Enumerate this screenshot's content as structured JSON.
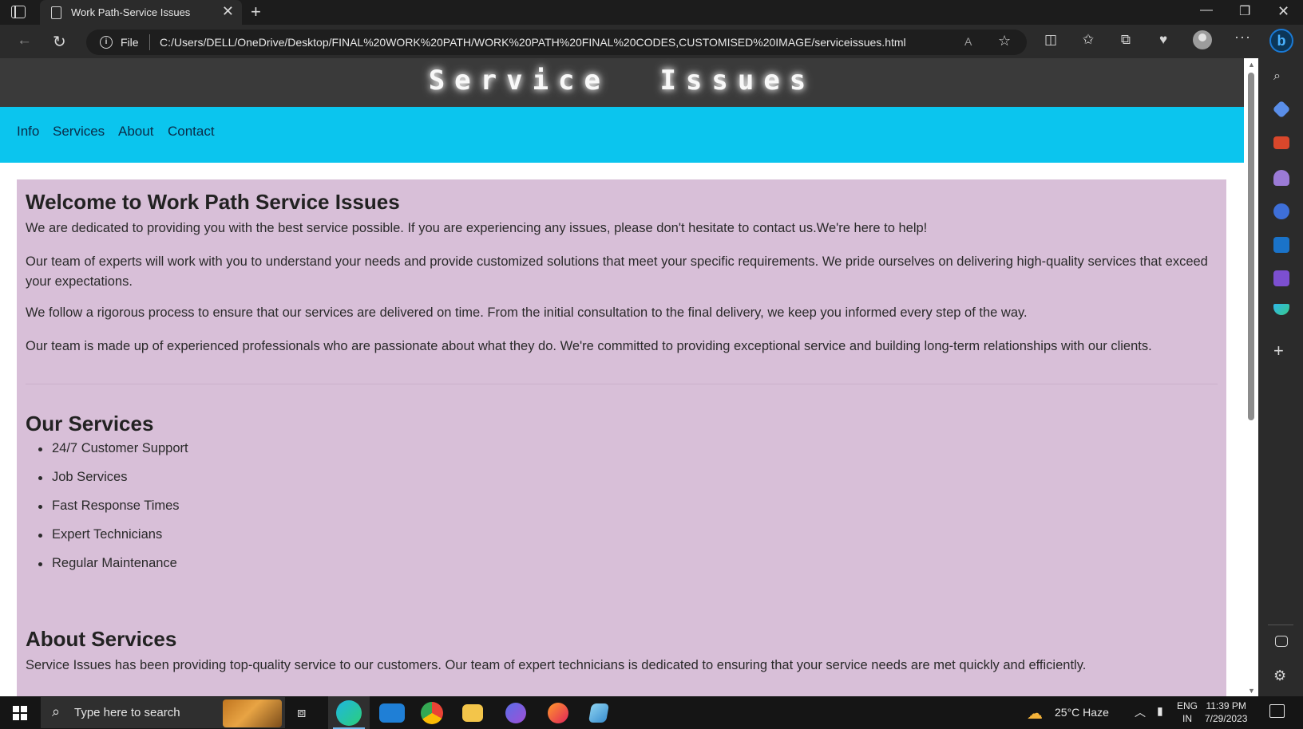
{
  "browser": {
    "tab_title": "Work Path-Service Issues",
    "tab_close": "✕",
    "new_tab": "+",
    "file_label": "File",
    "url": "C:/Users/DELL/OneDrive/Desktop/FINAL%20WORK%20PATH/WORK%20PATH%20FINAL%20CODES,CUSTOMISED%20IMAGE/serviceissues.html",
    "read_aloud_glyph": "A",
    "window_minimize": "—",
    "window_restore": "❐",
    "window_close": "✕"
  },
  "page": {
    "site_title": "Service Issues",
    "nav": [
      "Info",
      "Services",
      "About",
      "Contact"
    ],
    "welcome_heading": "Welcome to Work Path Service Issues",
    "paragraphs": [
      "We are dedicated to providing you with the best service possible. If you are experiencing any issues, please don't hesitate to contact us.We're here to help!",
      "Our team of experts will work with you to understand your needs and provide customized solutions that meet your specific requirements. We pride ourselves on delivering high-quality services that exceed your expectations.",
      "We follow a rigorous process to ensure that our services are delivered on time. From the initial consultation to the final delivery, we keep you informed every step of the way.",
      "Our team is made up of experienced professionals who are passionate about what they do. We're committed to providing exceptional service and building long-term relationships with our clients."
    ],
    "services_heading": "Our Services",
    "services": [
      "24/7 Customer Support",
      "Job Services",
      "Fast Response Times",
      "Expert Technicians",
      "Regular Maintenance"
    ],
    "about_heading": "About Services",
    "about_text": "Service Issues has been providing top-quality service to our customers. Our team of expert technicians is dedicated to ensuring that your service needs are met quickly and efficiently."
  },
  "taskbar": {
    "search_placeholder": "Type here to search",
    "weather": "25°C  Haze",
    "lang_top": "ENG",
    "lang_bottom": "IN",
    "time": "11:39 PM",
    "date": "7/29/2023"
  },
  "colors": {
    "header_bg": "#3a3a3a",
    "nav_bg": "#0bc5ee",
    "card_bg": "#d8bfd8"
  }
}
